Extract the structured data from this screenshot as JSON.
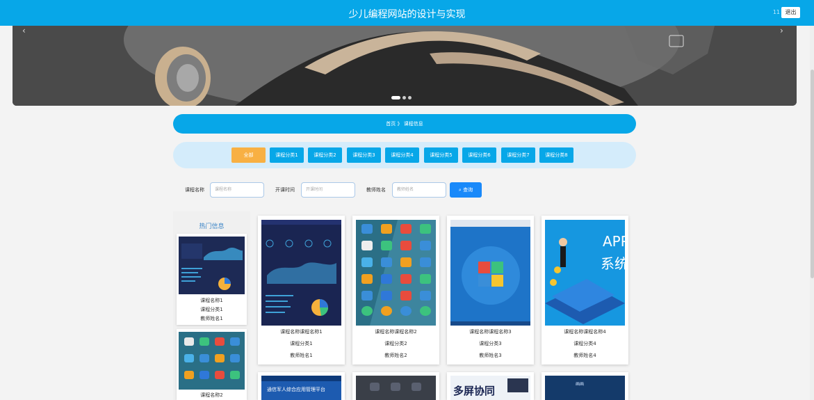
{
  "header": {
    "title": "少儿编程网站的设计与实现",
    "username": "11",
    "logout": "退出"
  },
  "banner": {
    "prev": "‹",
    "next": "›",
    "active_slide": 1,
    "slide_count": 3
  },
  "breadcrumb": {
    "home": "首页",
    "sep": "》",
    "current": "课程信息"
  },
  "categories": [
    "全部",
    "课程分类1",
    "课程分类2",
    "课程分类3",
    "课程分类4",
    "课程分类5",
    "课程分类6",
    "课程分类7",
    "课程分类8"
  ],
  "search": {
    "name_label": "课程名称",
    "name_placeholder": "课程名称",
    "time_label": "开课时间",
    "time_placeholder": "开课时间",
    "teacher_label": "教师姓名",
    "teacher_placeholder": "教师姓名",
    "button": "查询"
  },
  "hot": {
    "title": "热门信息",
    "items": [
      {
        "name": "课程名称1",
        "category": "课程分类1",
        "teacher": "教师姓名1"
      },
      {
        "name": "课程名称2"
      }
    ]
  },
  "courses": [
    {
      "name": "课程名称课程名称1",
      "category": "课程分类1",
      "teacher": "教师姓名1"
    },
    {
      "name": "课程名称课程名称2",
      "category": "课程分类2",
      "teacher": "教师姓名2"
    },
    {
      "name": "课程名称课程名称3",
      "category": "课程分类3",
      "teacher": "教师姓名3"
    },
    {
      "name": "课程名称课程名称4",
      "category": "课程分类4",
      "teacher": "教师姓名4"
    }
  ],
  "second_row": {
    "card1_text": "通信军人综合应用管理平台",
    "card3_text": "多屏协同",
    "card4_text": "画画"
  },
  "colors": {
    "primary": "#07a7e8",
    "accent": "#f8b043",
    "button": "#1989fa"
  }
}
